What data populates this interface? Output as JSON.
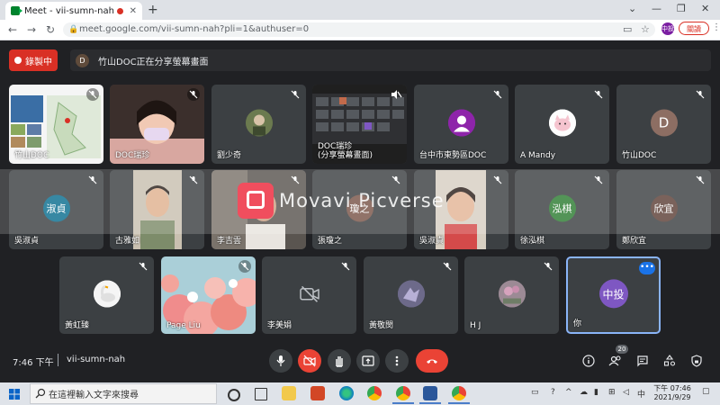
{
  "browser": {
    "tab_title": "Meet - vii-sumn-nah",
    "tab_close": "✕",
    "new_tab": "+",
    "url": "meet.google.com/vii-sumn-nah?pli=1&authuser=0",
    "profile_initials": "中投",
    "update_label": "關讀"
  },
  "meeting": {
    "record_label": "錄製中",
    "presenter_initial": "D",
    "presenting_text": "竹山DOC正在分享螢幕畫面",
    "time": "7:46 下午",
    "code": "vii-sumn-nah",
    "participant_count": "20"
  },
  "tiles_row1": [
    {
      "name": "竹山DOC",
      "type": "screen"
    },
    {
      "name": "DOC瑞珍",
      "type": "camera"
    },
    {
      "name": "劉少奇",
      "type": "avatar"
    },
    {
      "name": "DOC瑞珍\n(分享螢幕畫面)",
      "type": "screen2"
    },
    {
      "name": "台中市東勢區DOC",
      "type": "avatar"
    },
    {
      "name": "A Mandy",
      "type": "avatar"
    },
    {
      "name": "竹山DOC",
      "type": "avatar",
      "initial": "D"
    }
  ],
  "tiles_row2": [
    {
      "name": "吳淑貞",
      "initial": "淑貞"
    },
    {
      "name": "古雅如",
      "type": "camera"
    },
    {
      "name": "李吉雲",
      "type": "camera"
    },
    {
      "name": "張瓊之",
      "initial": "瓊之"
    },
    {
      "name": "吳淑貞",
      "type": "camera"
    },
    {
      "name": "徐泓棋",
      "initial": "泓棋"
    },
    {
      "name": "鄭欣宜",
      "initial": "欣宜"
    }
  ],
  "tiles_row3": [
    {
      "name": "黃虹臻"
    },
    {
      "name": "Page Liu"
    },
    {
      "name": "李美娟"
    },
    {
      "name": "黃敬閔"
    },
    {
      "name": "H J"
    },
    {
      "name": "你",
      "initial": "中投",
      "more": "•••"
    }
  ],
  "watermark": "Movavi Picverse",
  "taskbar": {
    "search_placeholder": "在這裡輸入文字來搜尋",
    "lang": "中",
    "time": "下午 07:46",
    "date": "2021/9/29"
  },
  "colors": {
    "meet_bg": "#202124",
    "tile_bg": "#3c4043",
    "record_red": "#d93025",
    "accent_blue": "#8ab4f8",
    "you_avatar": "#7e57c2"
  }
}
